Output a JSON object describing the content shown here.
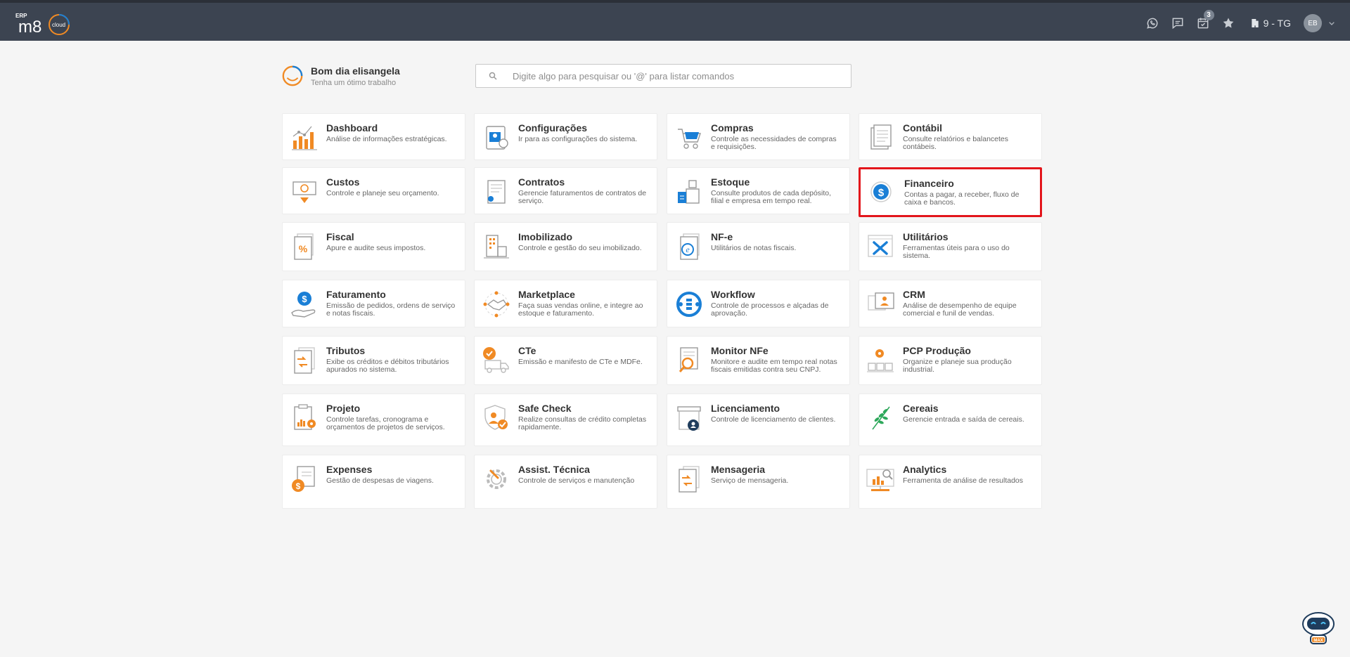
{
  "topbar": {
    "logo_erp": "ERP",
    "logo_brand": "m8",
    "logo_cloud": "cloud",
    "icons": [
      "whatsapp-icon",
      "chat-icon",
      "calendar-check-icon",
      "star-icon"
    ],
    "notifications_count": "3",
    "company": "9 - TG",
    "user_initials": "EB"
  },
  "greeting": {
    "title": "Bom dia elisangela",
    "subtitle": "Tenha um ótimo trabalho"
  },
  "search": {
    "placeholder": "Digite algo para pesquisar ou '@' para listar comandos"
  },
  "modules": [
    {
      "title": "Dashboard",
      "desc": "Análise de informações estratégicas.",
      "icon": "dashboard-icon"
    },
    {
      "title": "Configurações",
      "desc": "Ir para as configurações do sistema.",
      "icon": "settings-icon"
    },
    {
      "title": "Compras",
      "desc": "Controle as necessidades de compras e requisições.",
      "icon": "shopping-cart-icon"
    },
    {
      "title": "Contábil",
      "desc": "Consulte relatórios e balancetes contábeis.",
      "icon": "accounting-icon"
    },
    {
      "title": "Custos",
      "desc": "Controle e planeje seu orçamento.",
      "icon": "costs-icon"
    },
    {
      "title": "Contratos",
      "desc": "Gerencie faturamentos de contratos de serviço.",
      "icon": "contracts-icon"
    },
    {
      "title": "Estoque",
      "desc": "Consulte produtos de cada depósito, filial e empresa em tempo real.",
      "icon": "inventory-icon"
    },
    {
      "title": "Financeiro",
      "desc": "Contas a pagar, a receber, fluxo de caixa e bancos.",
      "icon": "dollar-icon"
    },
    {
      "title": "Fiscal",
      "desc": "Apure e audite seus impostos.",
      "icon": "percent-icon"
    },
    {
      "title": "Imobilizado",
      "desc": "Controle e gestão do seu imobilizado.",
      "icon": "building-icon"
    },
    {
      "title": "NF-e",
      "desc": "Utilitários de notas fiscais.",
      "icon": "nfe-icon"
    },
    {
      "title": "Utilitários",
      "desc": "Ferramentas úteis para o uso do sistema.",
      "icon": "tools-icon"
    },
    {
      "title": "Faturamento",
      "desc": "Emissão de pedidos, ordens de serviço e notas fiscais.",
      "icon": "billing-icon"
    },
    {
      "title": "Marketplace",
      "desc": "Faça suas vendas online, e integre ao estoque e faturamento.",
      "icon": "handshake-icon"
    },
    {
      "title": "Workflow",
      "desc": "Controle de processos e alçadas de aprovação.",
      "icon": "workflow-icon"
    },
    {
      "title": "CRM",
      "desc": "Análise de desempenho de equipe comercial e funil de vendas.",
      "icon": "crm-icon"
    },
    {
      "title": "Tributos",
      "desc": "Exibe os créditos e débitos tributários apurados no sistema.",
      "icon": "taxes-icon"
    },
    {
      "title": "CTe",
      "desc": "Emissão e manifesto de CTe e MDFe.",
      "icon": "truck-icon"
    },
    {
      "title": "Monitor NFe",
      "desc": "Monitore e audite em tempo real notas fiscais emitidas contra seu CNPJ.",
      "icon": "magnifier-icon"
    },
    {
      "title": "PCP Produção",
      "desc": "Organize e planeje sua produção industrial.",
      "icon": "production-icon"
    },
    {
      "title": "Projeto",
      "desc": "Controle tarefas, cronograma e orçamentos de projetos de serviços.",
      "icon": "project-icon"
    },
    {
      "title": "Safe Check",
      "desc": "Realize consultas de crédito completas rapidamente.",
      "icon": "shield-check-icon"
    },
    {
      "title": "Licenciamento",
      "desc": "Controle de licenciamento de clientes.",
      "icon": "license-icon"
    },
    {
      "title": "Cereais",
      "desc": "Gerencie entrada e saída de cereais.",
      "icon": "grain-icon"
    },
    {
      "title": "Expenses",
      "desc": "Gestão de despesas de viagens.",
      "icon": "expenses-icon"
    },
    {
      "title": "Assist. Técnica",
      "desc": "Controle de serviços e manutenção",
      "icon": "gear-service-icon"
    },
    {
      "title": "Mensageria",
      "desc": "Serviço de mensageria.",
      "icon": "messaging-icon"
    },
    {
      "title": "Analytics",
      "desc": "Ferramenta de análise de resultados",
      "icon": "analytics-icon"
    }
  ],
  "assistant": {
    "label": "MAX"
  },
  "colors": {
    "topbar": "#3c4451",
    "accent_orange": "#f08a24",
    "accent_blue": "#1a7fd6",
    "selected_border": "#e3151b"
  }
}
